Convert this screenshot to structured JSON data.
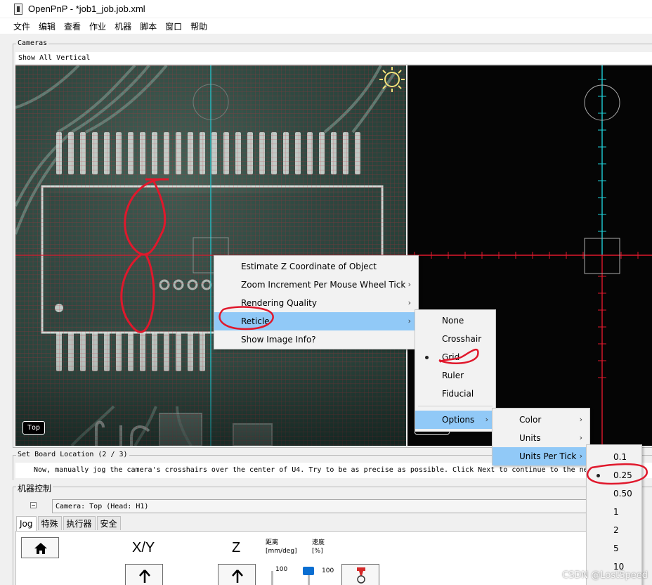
{
  "window": {
    "title": "OpenPnP - *job1_job.job.xml"
  },
  "menubar": [
    "文件",
    "编辑",
    "查看",
    "作业",
    "机器",
    "脚本",
    "窗口",
    "帮助"
  ],
  "cameras_panel": {
    "title": "Cameras",
    "layout_label": "Show All Vertical",
    "top_camera_tag": "Top",
    "bottom_camera_tag": "Bottom"
  },
  "context_menu": {
    "items": [
      "Estimate Z Coordinate of Object",
      "Zoom Increment Per Mouse Wheel Tick",
      "Rendering Quality",
      "Reticle",
      "Show Image Info?"
    ],
    "highlighted": "Reticle"
  },
  "reticle_menu": {
    "items": [
      "None",
      "Crosshair",
      "Grid",
      "Ruler",
      "Fiducial",
      "Options"
    ],
    "selected": "Grid",
    "highlighted": "Options"
  },
  "options_menu": {
    "items": [
      "Color",
      "Units",
      "Units Per Tick"
    ],
    "highlighted": "Units Per Tick"
  },
  "units_per_tick_menu": {
    "items": [
      "0.1",
      "0.25",
      "0.50",
      "1",
      "2",
      "5",
      "10"
    ],
    "selected": "0.25"
  },
  "board_location": {
    "title": "Set Board Location  (2 / 3)",
    "instruction": "Now, manually jog the camera's crosshairs over the center of U4. Try to be as precise as possible. Click Next to continue to the ne"
  },
  "machine_control": {
    "title": "机器控制",
    "camera_selector": "Camera: Top (Head: H1)",
    "tabs": [
      "Jog",
      "特殊",
      "执行器",
      "安全"
    ],
    "active_tab": "Jog",
    "xy_label": "X/Y",
    "z_label": "Z",
    "distance_label": "距离",
    "distance_unit": "[mm/deg]",
    "speed_label": "速度",
    "speed_unit": "[%]",
    "distance_value": "100",
    "speed_value": "100"
  },
  "watermark": "CSDN @LostSpeed",
  "colors": {
    "menu_highlight": "#91c9f7",
    "reticle_red": "#e0182c",
    "reticle_cyan": "#1ecfd8"
  }
}
